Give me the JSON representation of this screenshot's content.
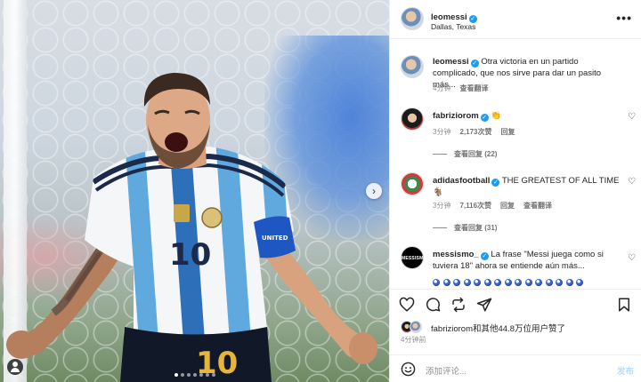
{
  "post": {
    "username": "leomessi",
    "location": "Dallas, Texas",
    "more_label": "•••"
  },
  "caption": {
    "username": "leomessi",
    "text": "Otra victoria en un partido complicado, que nos sirve para dar un pasito más...",
    "time": "4分钟",
    "translate_label": "查看翻译"
  },
  "comments": [
    {
      "username": "fabriziorom",
      "text": "👏",
      "time": "3分钟",
      "likes": "2,173次赞",
      "reply_label": "回复",
      "replies_label": "查看回复 (22)"
    },
    {
      "username": "adidasfootball",
      "text": "THE GREATEST OF ALL TIME",
      "extra": "🐐",
      "time": "3分钟",
      "likes": "7,116次赞",
      "reply_label": "回复",
      "translate_label": "查看翻译",
      "replies_label": "查看回复 (31)"
    },
    {
      "username": "messismo_",
      "text": "La frase \"Messi juega como si tuviera 18\" ahora se entiende aún más...",
      "avatar_text": "MESSISMO"
    }
  ],
  "likes": {
    "text": "fabriziorom和其他44.8万位用户赞了",
    "time": "4分钟前"
  },
  "composer": {
    "placeholder": "添加评论...",
    "post_label": "发布"
  },
  "photo": {
    "shirt_number": "10",
    "patch_text": "FIFA UNITED 2026"
  },
  "colors": {
    "verified": "#1d9bf0",
    "muted": "#8e8e8e",
    "post_button": "#b2dffc"
  }
}
